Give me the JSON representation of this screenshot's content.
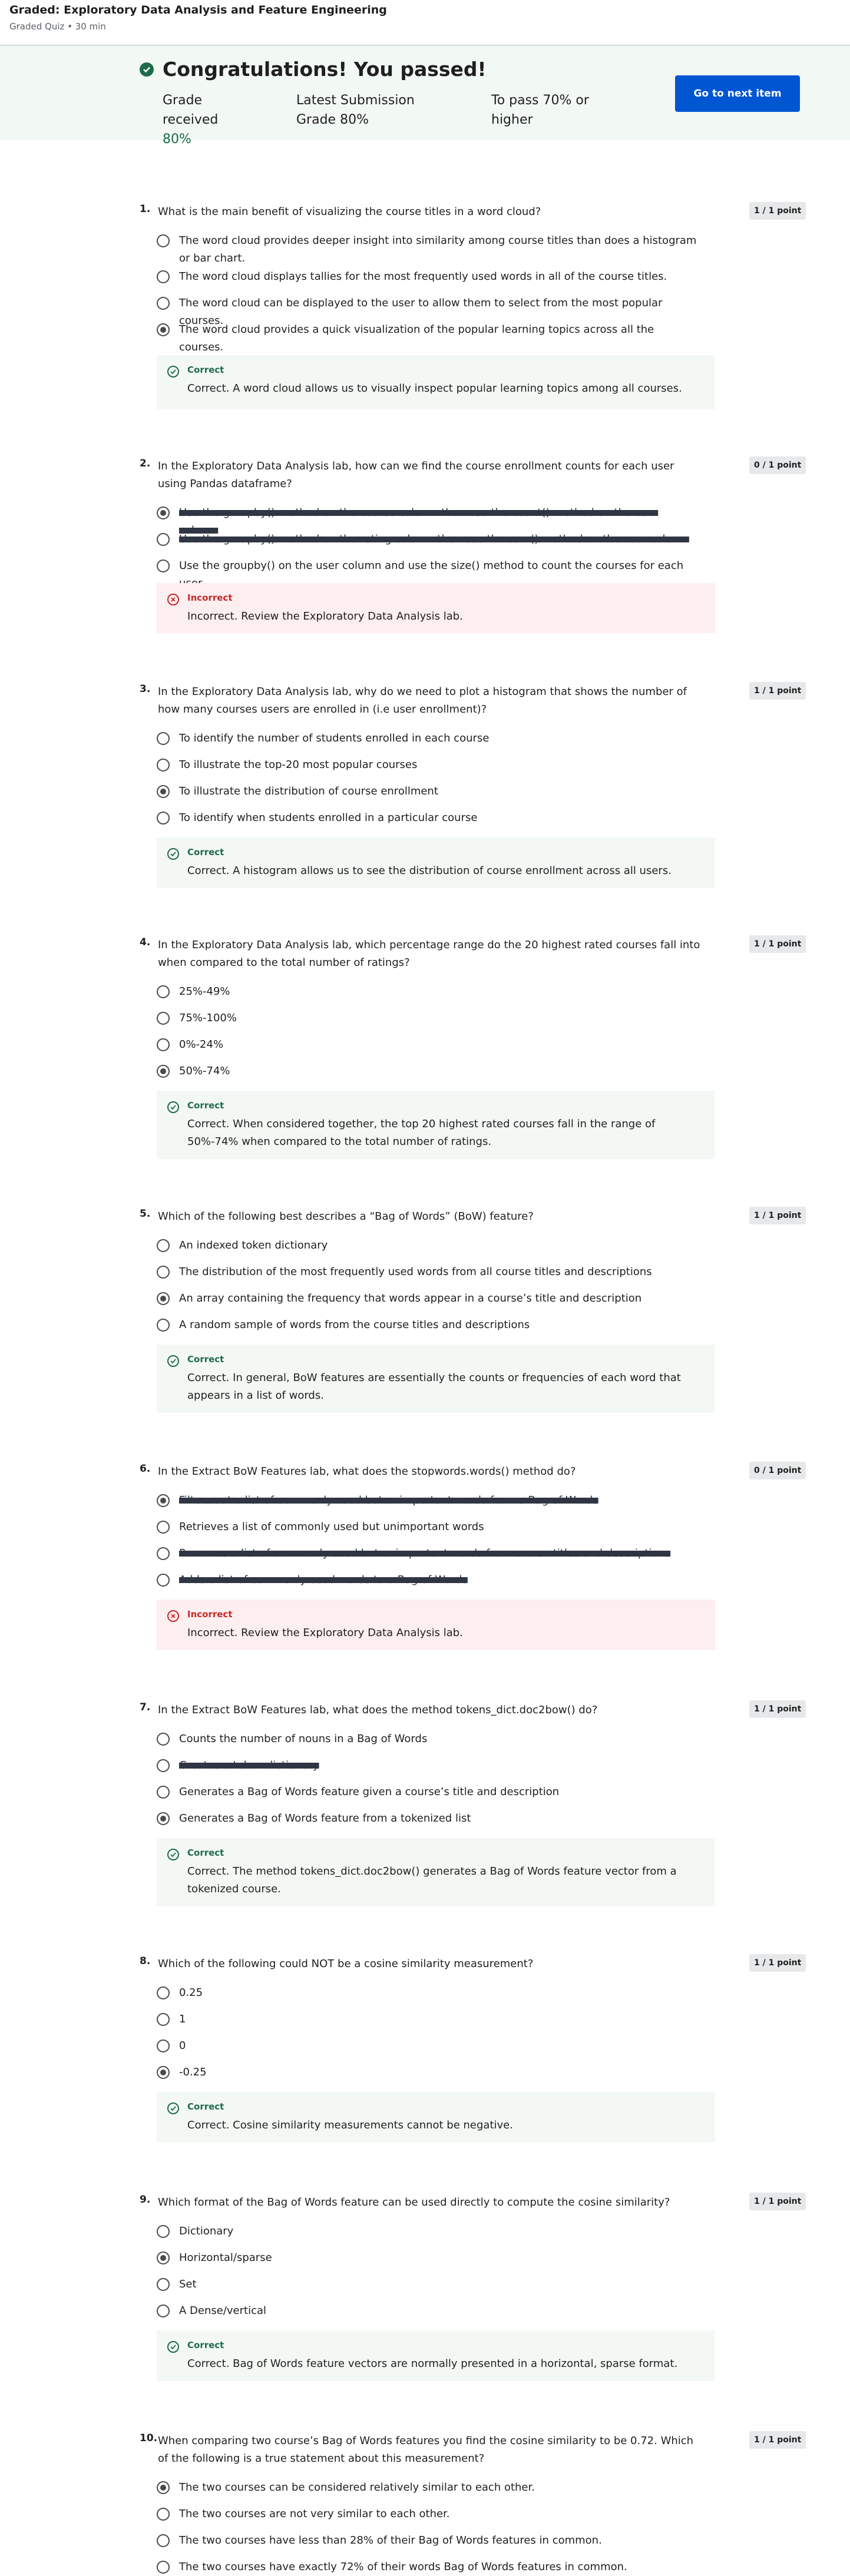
{
  "header": {
    "title": "Graded: Exploratory Data Analysis and Feature Engineering",
    "subtitle": "Graded Quiz • 30 min"
  },
  "banner": {
    "congrats": "Congratulations! You passed!",
    "grade_label": "Grade received",
    "grade_value": "80%",
    "latest_label": "Latest Submission Grade",
    "latest_value": "80%",
    "pass_label": "To pass",
    "pass_value": "70% or higher",
    "next_button": "Go to next item"
  },
  "questions": [
    {
      "num": "1.",
      "text": "What is the main benefit of visualizing the course titles in a word cloud?",
      "badge": "1 / 1 point",
      "options": [
        "The word cloud provides deeper insight into similarity among course titles than does a histogram or bar chart.",
        "The word cloud displays tallies for the most frequently used words in all of the course titles.",
        "The word cloud can be displayed to the user to allow them to select from the most popular courses.",
        "The word cloud provides a quick visualization of the popular learning topics across all the courses."
      ],
      "feedback_head": "Correct",
      "feedback_msg": "Correct. A word cloud allows us to visually inspect popular learning topics among all courses."
    },
    {
      "num": "2.",
      "text": "In the Exploratory Data Analysis lab, how can we find the course enrollment counts for each user using Pandas dataframe?",
      "badge": "0 / 1 point",
      "options": [
        "Use the groupby() method on the course column then use the count() method on the user column",
        "Use the groupby() method on the rating column then use the sum() method on the user column",
        "Use the groupby() on the user column and use the size() method to count the courses for each user."
      ],
      "feedback_head": "Incorrect",
      "feedback_msg": "Incorrect. Review the Exploratory Data Analysis lab."
    },
    {
      "num": "3.",
      "text": "In the Exploratory Data Analysis lab, why do we need to plot a histogram that shows the number of how many courses users are enrolled in (i.e user enrollment)?",
      "badge": "1 / 1 point",
      "options": [
        "To identify the number of students enrolled in each course",
        "To illustrate the top-20 most popular courses",
        "To illustrate the distribution of course enrollment",
        "To identify when students enrolled in a particular course"
      ],
      "feedback_head": "Correct",
      "feedback_msg": "Correct. A histogram allows us to see the distribution of course enrollment across all users."
    },
    {
      "num": "4.",
      "text": "In the Exploratory Data Analysis lab, which percentage range do the 20 highest rated courses fall into when compared to the total number of ratings?",
      "badge": "1 / 1 point",
      "options": [
        "25%-49%",
        "75%-100%",
        "0%-24%",
        "50%-74%"
      ],
      "feedback_head": "Correct",
      "feedback_msg": "Correct. When considered together, the top 20 highest rated courses fall in the range of 50%-74% when compared to the total number of ratings."
    },
    {
      "num": "5.",
      "text": "Which of the following best describes a “Bag of Words” (BoW) feature?",
      "badge": "1 / 1 point",
      "options": [
        "An indexed token dictionary",
        "The distribution of the most frequently used words from all course titles and descriptions",
        "An array containing the frequency that words appear in a course’s title and description",
        "A random sample of words from the course titles and descriptions"
      ],
      "feedback_head": "Correct",
      "feedback_msg": "Correct. In general, BoW features are essentially the counts or frequencies of each word that appears in a list of words."
    },
    {
      "num": "6.",
      "text": "In the Extract BoW Features lab, what does the stopwords.words() method do?",
      "badge": "0 / 1 point",
      "options": [
        "Filters out a list of commonly used but unimportant words from a Bag of Words",
        "Retrieves a list of commonly used but unimportant words",
        "Removes a list of commonly used but unimportant words from course titles and descriptions",
        "Adds a list of commonly used words to a Bag of Words"
      ],
      "feedback_head": "Incorrect",
      "feedback_msg": "Incorrect. Review the Exploratory Data Analysis lab."
    },
    {
      "num": "7.",
      "text": "In the Extract BoW Features lab, what does the method tokens_dict.doc2bow() do?",
      "badge": "1 / 1 point",
      "options": [
        "Counts the number of nouns in a Bag of Words",
        "Creates a token dictionary",
        "Generates a Bag of Words feature given a course’s title and description",
        "Generates a Bag of Words feature from a tokenized list"
      ],
      "feedback_head": "Correct",
      "feedback_msg": "Correct. The method tokens_dict.doc2bow() generates a Bag of Words feature vector from a tokenized course."
    },
    {
      "num": "8.",
      "text": "Which of the following could NOT be a cosine similarity measurement?",
      "badge": "1 / 1 point",
      "options": [
        "0.25",
        "1",
        "0",
        "-0.25"
      ],
      "feedback_head": "Correct",
      "feedback_msg": "Correct. Cosine similarity measurements cannot be negative."
    },
    {
      "num": "9.",
      "text": "Which format of the Bag of Words feature can be used directly to compute the cosine similarity?",
      "badge": "1 / 1 point",
      "options": [
        "Dictionary",
        "Horizontal/sparse",
        "Set",
        "A Dense/vertical"
      ],
      "feedback_head": "Correct",
      "feedback_msg": "Correct. Bag of Words feature vectors are normally presented in a horizontal, sparse format."
    },
    {
      "num": "10.",
      "text": "When comparing two course’s Bag of Words features you find the cosine similarity to be 0.72. Which of the following is a true statement about this measurement?",
      "badge": "1 / 1 point",
      "options": [
        "The two courses can be considered relatively similar to each other.",
        "The two courses are not very similar to each other.",
        "The two courses have less than 28% of their Bag of Words features in common.",
        "The two courses have exactly 72% of their words Bag of Words features in common."
      ]
    }
  ]
}
